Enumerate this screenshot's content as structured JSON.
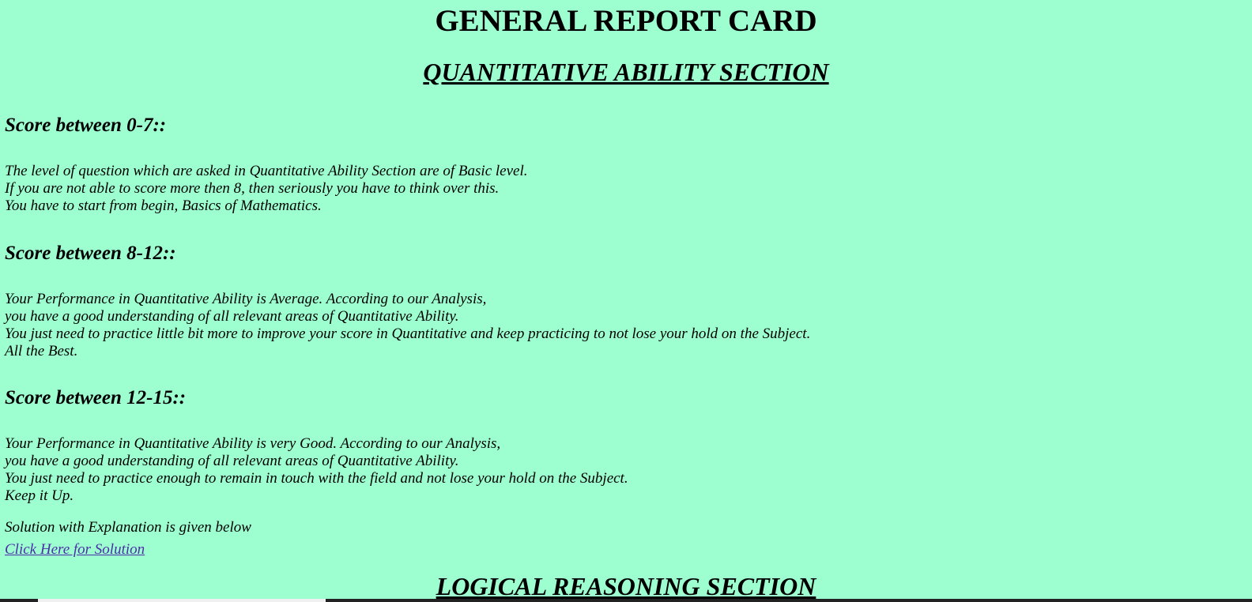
{
  "page": {
    "title": "GENERAL REPORT CARD"
  },
  "quant_section": {
    "title": "QUANTITATIVE ABILITY SECTION",
    "blocks": [
      {
        "heading": "Score between 0-7::",
        "lines": [
          "The level of question which are asked in Quantitative Ability Section are of Basic level.",
          "If you are not able to score more then 8, then seriously you have to think over this.",
          "You have to start from begin, Basics of Mathematics."
        ]
      },
      {
        "heading": "Score between 8-12::",
        "lines": [
          "Your Performance in Quantitative Ability is Average. According to our Analysis,",
          "you have a good understanding of all relevant areas of Quantitative Ability.",
          "You just need to practice little bit more to improve your score in Quantitative and keep practicing to not lose your hold on the Subject.",
          "All the Best."
        ]
      },
      {
        "heading": "Score between 12-15::",
        "lines": [
          "Your Performance in Quantitative Ability is very Good. According to our Analysis,",
          "you have a good understanding of all relevant areas of Quantitative Ability.",
          "You just need to practice enough to remain in touch with the field and not lose your hold on the Subject.",
          "Keep it Up."
        ]
      }
    ],
    "solution_note": "Solution with Explanation is given below",
    "solution_link": "Click Here for Solution"
  },
  "logical_section": {
    "title": "LOGICAL REASONING SECTION"
  },
  "colors": {
    "background": "#9dffd0",
    "link": "#4b2ea8"
  }
}
